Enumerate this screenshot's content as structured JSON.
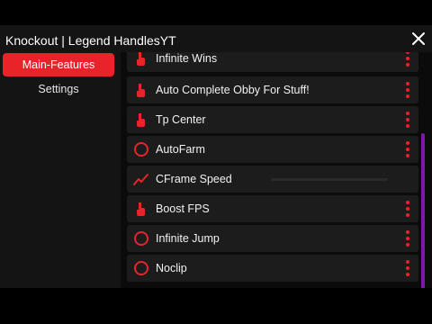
{
  "window": {
    "title": "Knockout | Legend HandlesYT"
  },
  "sidebar": {
    "items": [
      {
        "label": "Main-Features",
        "active": true
      },
      {
        "label": "Settings",
        "active": false
      }
    ]
  },
  "features": [
    {
      "label": "Infinite Wins",
      "icon": "tap-icon"
    },
    {
      "label": "Auto Complete Obby For Stuff!",
      "icon": "tap-icon"
    },
    {
      "label": "Tp Center",
      "icon": "tap-icon"
    },
    {
      "label": "AutoFarm",
      "icon": "toggle-circle-icon"
    },
    {
      "label": "CFrame Speed",
      "icon": "trend-icon"
    },
    {
      "label": "Boost FPS",
      "icon": "tap-icon"
    },
    {
      "label": "Infinite Jump",
      "icon": "toggle-circle-icon"
    },
    {
      "label": "Noclip",
      "icon": "toggle-circle-icon"
    }
  ],
  "colors": {
    "accent": "#e8232a",
    "scrollbar": "#7a1aa6",
    "panel": "#1c1c1c"
  }
}
